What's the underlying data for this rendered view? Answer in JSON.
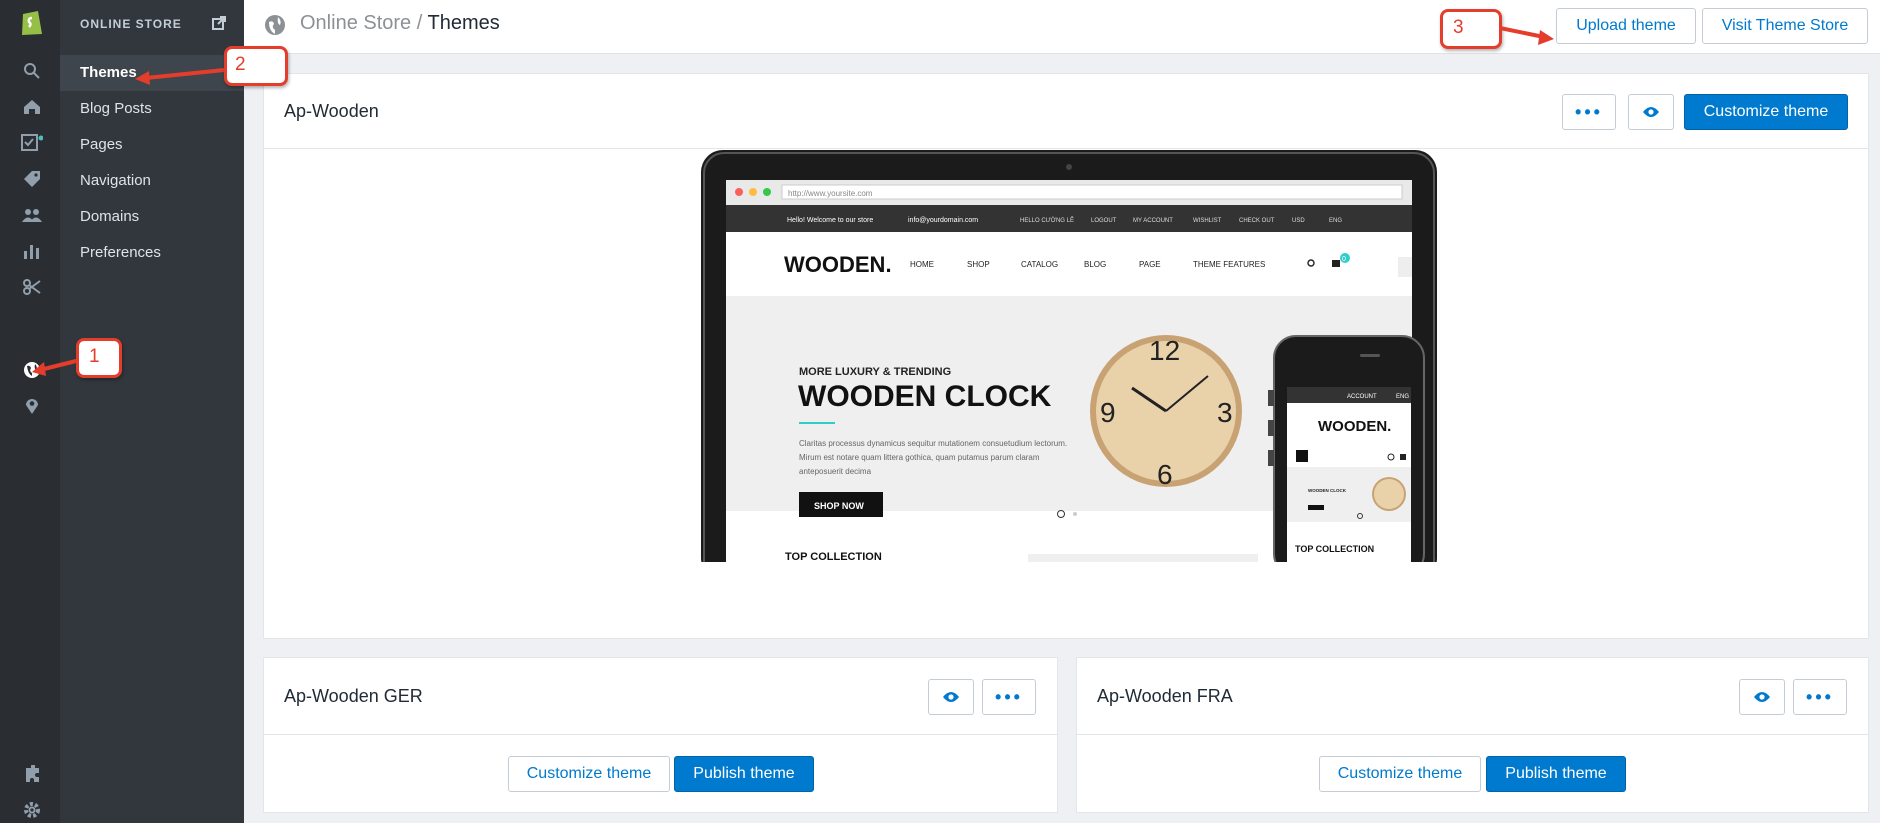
{
  "colors": {
    "accent": "#007ace",
    "annotation": "#e53d2c",
    "rail": "#2a2e33",
    "nav": "#31373d"
  },
  "rail_icons": [
    "shopify-logo",
    "search-icon",
    "home-icon",
    "orders-icon",
    "tag-icon",
    "customers-icon",
    "analytics-icon",
    "discounts-icon",
    "globe-icon",
    "location-icon",
    "apps-icon",
    "settings-icon"
  ],
  "sidebar": {
    "header": "ONLINE STORE",
    "items": [
      {
        "label": "Themes"
      },
      {
        "label": "Blog Posts"
      },
      {
        "label": "Pages"
      },
      {
        "label": "Navigation"
      },
      {
        "label": "Domains"
      },
      {
        "label": "Preferences"
      }
    ]
  },
  "breadcrumb": {
    "parent": "Online Store /",
    "current": "Themes"
  },
  "header": {
    "upload_label": "Upload theme",
    "visit_label": "Visit Theme Store"
  },
  "main_theme": {
    "name": "Ap-Wooden",
    "more_label": "•••",
    "customize_label": "Customize theme"
  },
  "preview": {
    "url": "http://www.yoursite.com",
    "welcome": "Hello! Welcome to our store",
    "email": "info@yourdomain.com",
    "top_links": [
      "HELLO CƯỜNG LÊ",
      "LOGOUT",
      "MY ACCOUNT",
      "WISHLIST",
      "CHECK OUT",
      "USD",
      "ENG"
    ],
    "logo": "WOODEN.",
    "menu": [
      "HOME",
      "SHOP",
      "CATALOG",
      "BLOG",
      "PAGE",
      "THEME FEATURES"
    ],
    "cart_count": "0",
    "hero_kicker": "MORE LUXURY & TRENDING",
    "hero_title": "WOODEN CLOCK",
    "hero_text": [
      "Claritas processus dynamicus sequitur mutationem consuetudium lectorum.",
      "Mirum est notare quam littera gothica, quam putamus parum claram",
      "anteposuerit decima"
    ],
    "hero_button": "SHOP NOW",
    "clock_numbers": [
      "12",
      "3",
      "6",
      "9"
    ],
    "section": "TOP COLLECTION",
    "phone_account": "ACCOUNT",
    "phone_lang": "ENG",
    "phone_logo": "WOODEN.",
    "phone_clock_title": "WOODEN CLOCK",
    "phone_section": "TOP COLLECTION"
  },
  "themes": [
    {
      "name": "Ap-Wooden GER",
      "more_label": "•••",
      "customize_label": "Customize theme",
      "publish_label": "Publish theme"
    },
    {
      "name": "Ap-Wooden FRA",
      "more_label": "•••",
      "customize_label": "Customize theme",
      "publish_label": "Publish theme"
    }
  ],
  "annotations": [
    "1",
    "2",
    "3"
  ]
}
